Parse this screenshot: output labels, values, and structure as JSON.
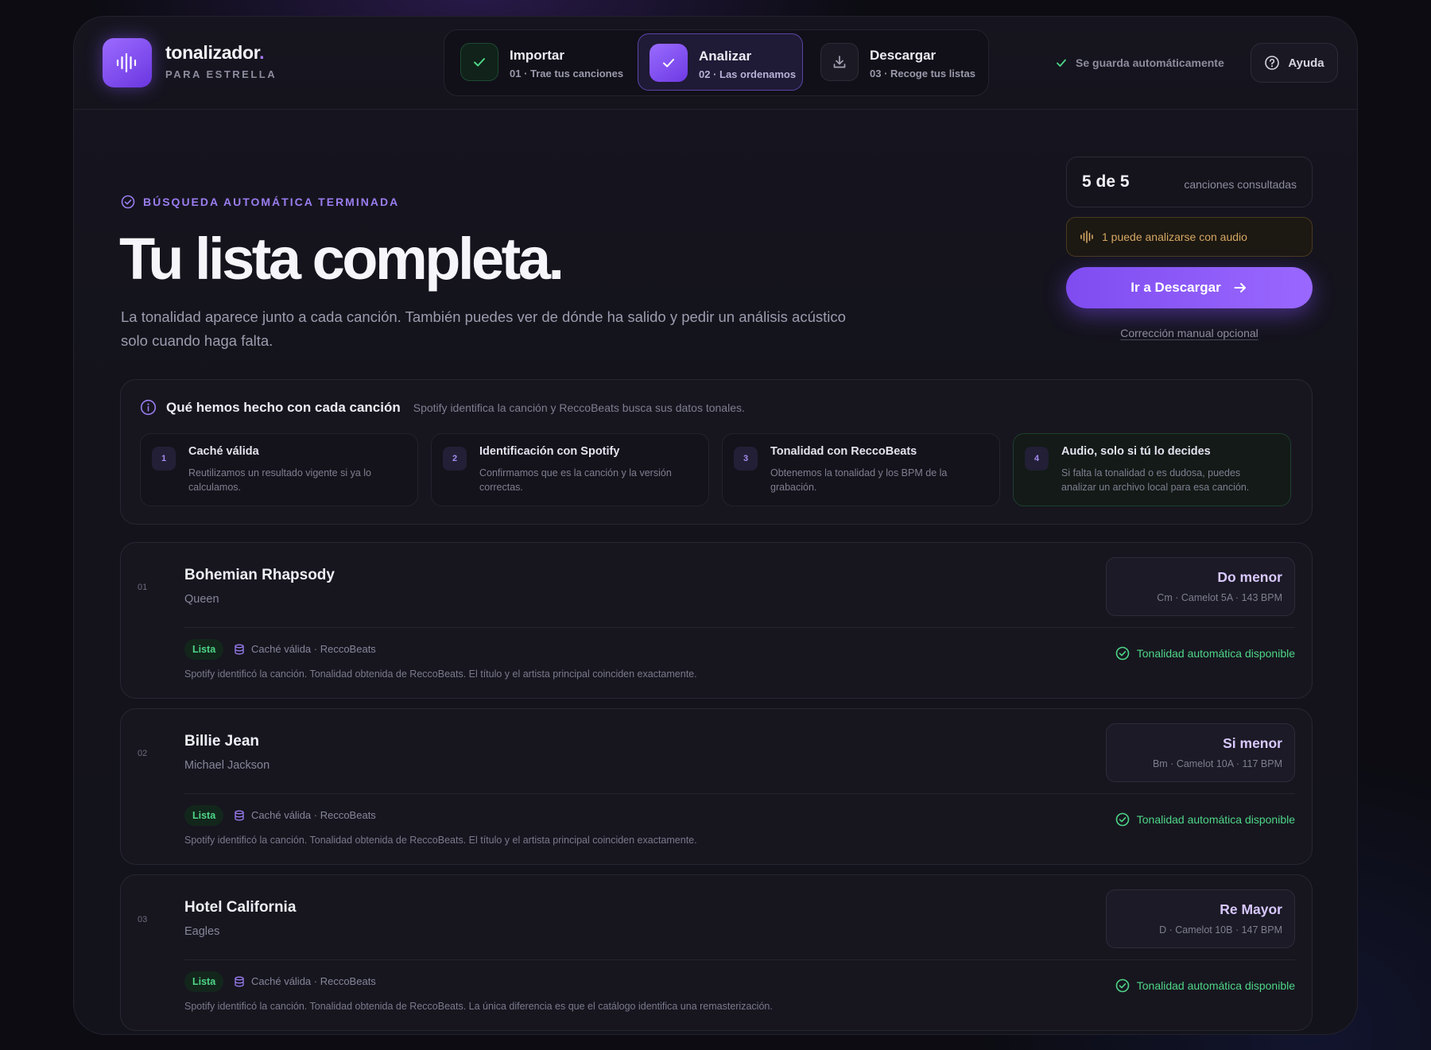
{
  "brand": {
    "name": "tonalizador",
    "dot": ".",
    "subtitle": "PARA ESTRELLA"
  },
  "steps": [
    {
      "title": "Importar",
      "sub": "01 · Trae tus canciones",
      "state": "done"
    },
    {
      "title": "Analizar",
      "sub": "02 · Las ordenamos",
      "state": "active"
    },
    {
      "title": "Descargar",
      "sub": "03 · Recoge tus listas",
      "state": "pending"
    }
  ],
  "header": {
    "saved": "Se guarda automáticamente",
    "help": "Ayuda"
  },
  "hero": {
    "kicker": "BÚSQUEDA AUTOMÁTICA TERMINADA",
    "title": "Tu lista completa.",
    "description": "La tonalidad aparece junto a cada canción. También puedes ver de dónde ha salido y pedir un análisis acústico solo cuando haga falta."
  },
  "summary": {
    "count": "5 de 5",
    "count_label": "canciones consultadas",
    "audio_note": "1 puede analizarse con audio",
    "cta": "Ir a Descargar",
    "manual": "Corrección manual opcional"
  },
  "info": {
    "title": "Qué hemos hecho con cada canción",
    "subtitle": "Spotify identifica la canción y ReccoBeats busca sus datos tonales.",
    "cards": [
      {
        "num": "1",
        "title": "Caché válida",
        "desc": "Reutilizamos un resultado vigente si ya lo calculamos."
      },
      {
        "num": "2",
        "title": "Identificación con Spotify",
        "desc": "Confirmamos que es la canción y la versión correctas."
      },
      {
        "num": "3",
        "title": "Tonalidad con ReccoBeats",
        "desc": "Obtenemos la tonalidad y los BPM de la grabación."
      },
      {
        "num": "4",
        "title": "Audio, solo si tú lo decides",
        "desc": "Si falta la tonalidad o es dudosa, puedes analizar un archivo local para esa canción."
      }
    ]
  },
  "tracks": [
    {
      "idx": "01",
      "title": "Bohemian Rhapsody",
      "artist": "Queen",
      "key": "Do menor",
      "key_meta": "Cm · Camelot 5A · 143 BPM",
      "badge": "Lista",
      "source": "Caché válida · ReccoBeats",
      "note": "Spotify identificó la canción. Tonalidad obtenida de ReccoBeats. El título y el artista principal coinciden exactamente.",
      "status": "Tonalidad automática disponible"
    },
    {
      "idx": "02",
      "title": "Billie Jean",
      "artist": "Michael Jackson",
      "key": "Si menor",
      "key_meta": "Bm · Camelot 10A · 117 BPM",
      "badge": "Lista",
      "source": "Caché válida · ReccoBeats",
      "note": "Spotify identificó la canción. Tonalidad obtenida de ReccoBeats. El título y el artista principal coinciden exactamente.",
      "status": "Tonalidad automática disponible"
    },
    {
      "idx": "03",
      "title": "Hotel California",
      "artist": "Eagles",
      "key": "Re Mayor",
      "key_meta": "D · Camelot 10B · 147 BPM",
      "badge": "Lista",
      "source": "Caché válida · ReccoBeats",
      "note": "Spotify identificó la canción. Tonalidad obtenida de ReccoBeats. La única diferencia es que el catálogo identifica una remasterización.",
      "status": "Tonalidad automática disponible"
    }
  ],
  "colors": {
    "accent": "#8b5cf6",
    "success": "#4ed587",
    "warning": "#d6a863"
  },
  "icons": [
    "waveform-icon",
    "check-icon",
    "download-icon",
    "help-circle-icon",
    "check-circle-icon",
    "info-icon",
    "arrow-right-icon",
    "database-icon"
  ]
}
